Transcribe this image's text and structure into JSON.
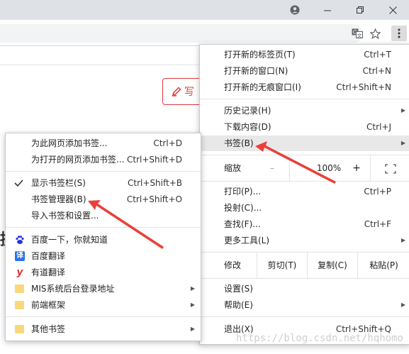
{
  "window": {
    "profile_icon": "account-circle-icon",
    "minimize_icon": "minimize-icon",
    "restore_icon": "restore-icon",
    "close_icon": "close-icon"
  },
  "toolbar": {
    "translate_icon": "translate-icon",
    "star_icon": "star-icon",
    "menu_icon": "more-vert-icon"
  },
  "page": {
    "write_button": "写",
    "left_glyph": "据"
  },
  "main_menu": {
    "items": [
      {
        "label": "打开新的标签页(T)",
        "shortcut": "Ctrl+T"
      },
      {
        "label": "打开新的窗口(N)",
        "shortcut": "Ctrl+N"
      },
      {
        "label": "打开新的无痕窗口(I)",
        "shortcut": "Ctrl+Shift+N"
      },
      {
        "label": "历史记录(H)",
        "shortcut": ""
      },
      {
        "label": "下载内容(D)",
        "shortcut": "Ctrl+J"
      },
      {
        "label": "书签(B)",
        "shortcut": ""
      },
      {
        "label": "打印(P)...",
        "shortcut": "Ctrl+P"
      },
      {
        "label": "投射(C)...",
        "shortcut": ""
      },
      {
        "label": "查找(F)...",
        "shortcut": "Ctrl+F"
      },
      {
        "label": "更多工具(L)",
        "shortcut": ""
      },
      {
        "label": "设置(S)",
        "shortcut": ""
      },
      {
        "label": "帮助(E)",
        "shortcut": ""
      },
      {
        "label": "退出(X)",
        "shortcut": "Ctrl+Shift+Q"
      }
    ],
    "zoom": {
      "label": "缩放",
      "minus": "–",
      "value": "100%",
      "plus": "+",
      "fullscreen_icon": "fullscreen-icon"
    },
    "edit": {
      "label": "修改",
      "cut": "剪切(T)",
      "copy": "复制(C)",
      "paste": "粘贴(P)"
    }
  },
  "bookmark_menu": {
    "items": [
      {
        "label": "为此网页添加书签...",
        "shortcut": "Ctrl+D"
      },
      {
        "label": "为打开的网页添加书签...",
        "shortcut": "Ctrl+Shift+D"
      },
      {
        "label": "显示书签栏(S)",
        "shortcut": "Ctrl+Shift+B",
        "checked": true
      },
      {
        "label": "书签管理器(B)",
        "shortcut": "Ctrl+Shift+O"
      },
      {
        "label": "导入书签和设置...",
        "shortcut": ""
      }
    ],
    "bookmarks": [
      {
        "label": "百度一下，你就知道",
        "icon": "baidu-paw-icon",
        "color": "#2932e1"
      },
      {
        "label": "百度翻译",
        "icon": "baidu-translate-icon",
        "glyph": "译",
        "color": "#2b73e8"
      },
      {
        "label": "有道翻译",
        "icon": "youdao-icon",
        "glyph": "y",
        "color": "#e0393e"
      },
      {
        "label": "MIS系统后台登录地址",
        "icon": "folder-icon"
      },
      {
        "label": "前端框架",
        "icon": "folder-icon"
      },
      {
        "label": "其他书签",
        "icon": "folder-icon"
      }
    ]
  },
  "watermark": "https://blog.csdn.net/hqhomo",
  "colors": {
    "arrow": "#e8413b",
    "highlight": "#e8e8e8",
    "folder": "#f7d87c"
  }
}
